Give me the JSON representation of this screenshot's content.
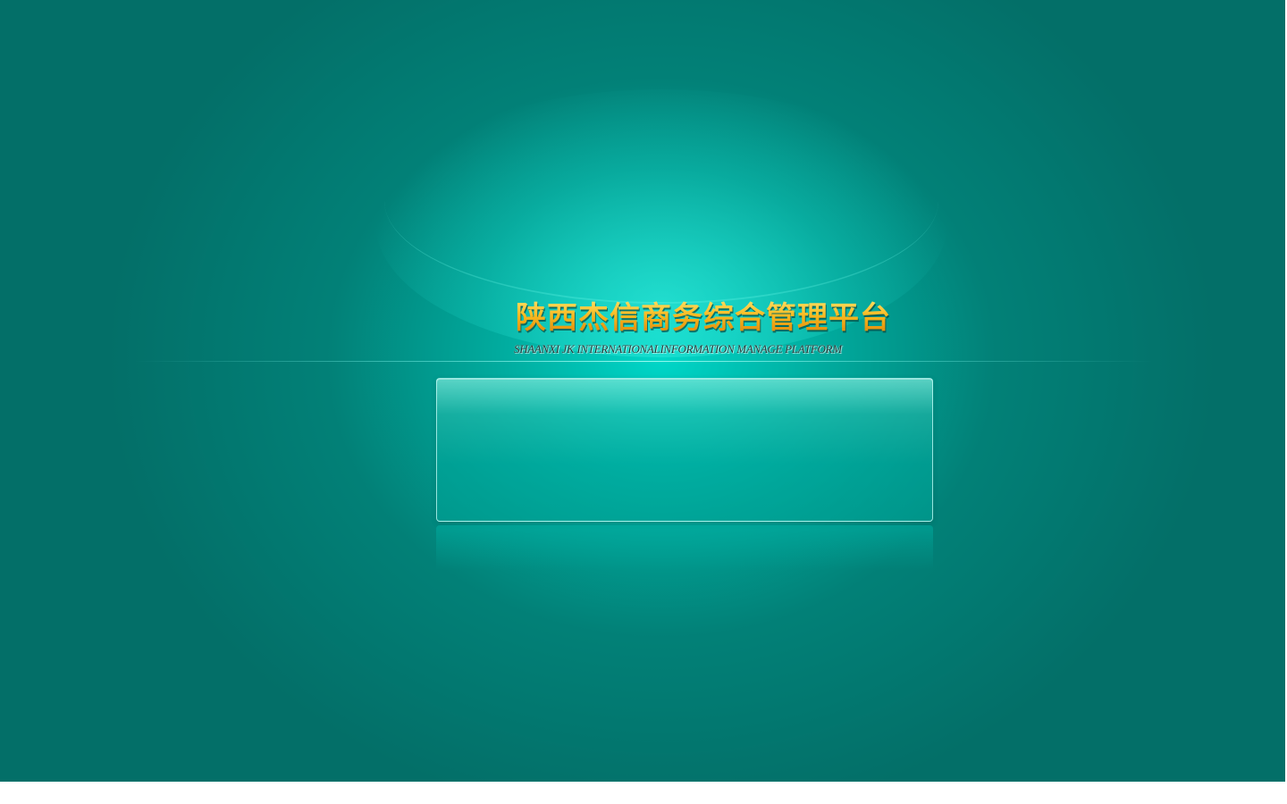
{
  "page": {
    "title_cn": "陕西杰信商务综合管理平台",
    "title_en": "SHAANXI JK INTERNATIONALINFORMATION MANAGE PLATFORM"
  },
  "colors": {
    "background": "#036f68",
    "glow": "#00dccd",
    "title_gold": "#f2a617",
    "panel": "#05aa9e"
  }
}
